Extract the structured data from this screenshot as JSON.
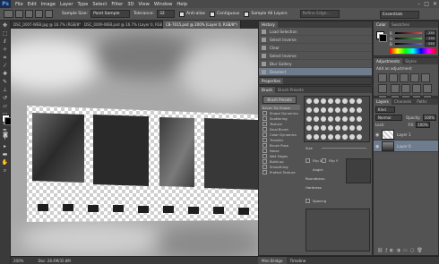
{
  "app": {
    "logo": "Ps"
  },
  "menu": [
    "File",
    "Edit",
    "Image",
    "Layer",
    "Type",
    "Select",
    "Filter",
    "3D",
    "View",
    "Window",
    "Help"
  ],
  "window_controls": [
    "–",
    "□",
    "✕"
  ],
  "options": {
    "sample_size_label": "Sample Size:",
    "sample_size_value": "Point Sample",
    "tolerance_label": "Tolerance:",
    "tolerance_value": "32",
    "anti_alias": "Anti-alias",
    "contiguous": "Contiguous",
    "sample_all_layers": "Sample All Layers",
    "refine_edge": "Refine Edge...",
    "workspace": "Essentials"
  },
  "tabs": [
    {
      "label": "DSC_0007-WEB.jpg @ 16.7% (RGB/8*)",
      "active": false
    },
    {
      "label": "DSC_0009-WEB.psd @ 16.7% (Layer 0, RGB/8)",
      "active": false
    },
    {
      "label": "CB-7015.psd @ 200% (Layer 0, RGB/8*)",
      "active": true
    }
  ],
  "status": {
    "zoom": "200%",
    "doc": "Doc: 28.4M/35.8M"
  },
  "history": {
    "tabs": [
      "History"
    ],
    "items": [
      {
        "label": "Load Selection",
        "selected": false
      },
      {
        "label": "Select Inverse",
        "selected": false
      },
      {
        "label": "Clear",
        "selected": false
      },
      {
        "label": "Select Inverse",
        "selected": false
      },
      {
        "label": "Blur Gallery",
        "selected": false
      },
      {
        "label": "Deselect",
        "selected": true
      }
    ]
  },
  "properties": {
    "tab": "Properties"
  },
  "brush": {
    "tabs": [
      "Brush",
      "Brush Presets"
    ],
    "presets_button": "Brush Presets",
    "options": [
      "Brush Tip Shape",
      "Shape Dynamics",
      "Scattering",
      "Texture",
      "Dual Brush",
      "Color Dynamics",
      "Transfer",
      "Brush Pose",
      "Noise",
      "Wet Edges",
      "Build-up",
      "Smoothing",
      "Protect Texture"
    ],
    "size_label": "Size",
    "flip_x": "Flip X",
    "flip_y": "Flip Y",
    "angle_label": "Angle:",
    "roundness_label": "Roundness:",
    "hardness_label": "Hardness",
    "spacing_label": "Spacing"
  },
  "color": {
    "tabs": [
      "Color",
      "Swatches"
    ],
    "rows": [
      {
        "label": "R",
        "value": "255",
        "color": "#e05050"
      },
      {
        "label": "G",
        "value": "255",
        "color": "#50c050"
      },
      {
        "label": "B",
        "value": "255",
        "color": "#5070e0"
      }
    ]
  },
  "adjustments": {
    "tabs": [
      "Adjustments",
      "Styles"
    ],
    "title": "Add an adjustment"
  },
  "layers": {
    "tabs": [
      "Layers",
      "Channels",
      "Paths"
    ],
    "kind": "Kind",
    "blend_mode": "Normal",
    "opacity_label": "Opacity:",
    "opacity_value": "100%",
    "lock_label": "Lock:",
    "fill_label": "Fill:",
    "fill_value": "100%",
    "rows": [
      {
        "name": "Layer 1",
        "selected": false
      },
      {
        "name": "Layer 0",
        "selected": true
      }
    ]
  },
  "bottom_tabs": [
    "Mini Bridge",
    "Timeline"
  ],
  "colors": {
    "accent": "#6f7c8d",
    "panel": "#535353",
    "background": "#3c3c3c"
  }
}
